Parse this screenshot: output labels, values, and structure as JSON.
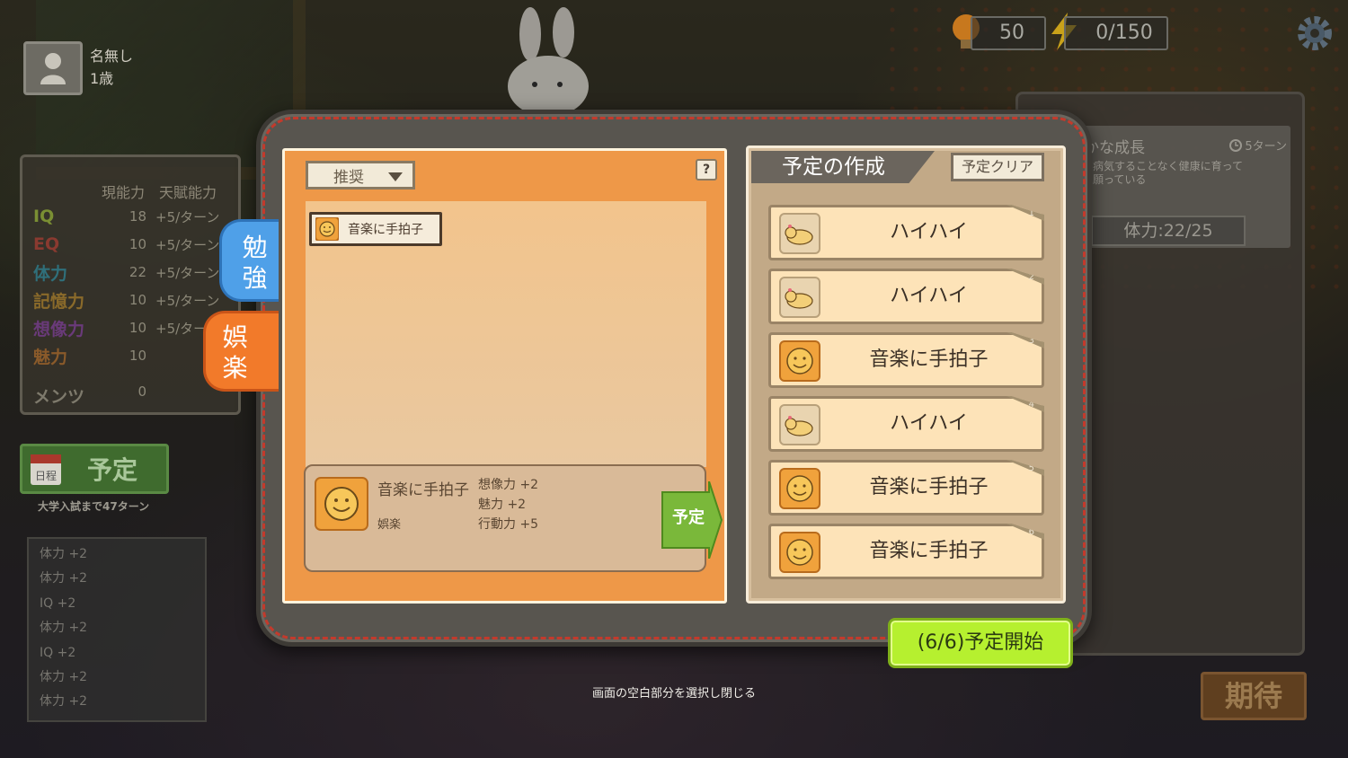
{
  "profile": {
    "name": "名無し",
    "age": "1歳"
  },
  "resources": {
    "bulb": "50",
    "energy": "0/150"
  },
  "stats": {
    "headers": [
      "現能力",
      "天賦能力"
    ],
    "rows": [
      {
        "name": "IQ",
        "value": "18",
        "rate": "+5/ターン",
        "color": "#7a8f33"
      },
      {
        "name": "EQ",
        "value": "10",
        "rate": "+5/ターン",
        "color": "#8a3a30"
      },
      {
        "name": "体力",
        "value": "22",
        "rate": "+5/ターン",
        "color": "#2f6f7a"
      },
      {
        "name": "記憶力",
        "value": "10",
        "rate": "+5/ターン",
        "color": "#8a6a2a"
      },
      {
        "name": "想像力",
        "value": "10",
        "rate": "+5/ター",
        "color": "#6a3a7a"
      },
      {
        "name": "魅力",
        "value": "10",
        "rate": "",
        "color": "#8a5a2a"
      }
    ],
    "mental": {
      "name": "メンツ",
      "value": "0"
    }
  },
  "schedule_button": {
    "calendar": "日程",
    "label": "予定"
  },
  "exam_turns": "大学入試まで47ターン",
  "log": [
    "体力 +2",
    "体力 +2",
    "IQ +2",
    "体力 +2",
    "IQ +2",
    "体力 +2",
    "体力 +2"
  ],
  "growth": {
    "title": "かな成長",
    "turns": "5ターン",
    "desc": "、病気することなく健康に育って\nと願っている",
    "hp": "体力:22/25"
  },
  "expect_button": "期待",
  "tabs": {
    "study": [
      "勉",
      "強"
    ],
    "fun": [
      "娯",
      "楽"
    ]
  },
  "sort": {
    "selected": "推奨"
  },
  "help": "?",
  "activity_list": [
    {
      "label": "音楽に手拍子",
      "icon": "smile-icon"
    }
  ],
  "detail": {
    "name": "音楽に手拍子",
    "category": "娯楽",
    "effects": [
      "想像力 +2",
      "魅力 +2",
      "行動力 +5"
    ],
    "plan_button": "予定"
  },
  "schedule": {
    "title": "予定の作成",
    "clear": "予定クリア",
    "slots": [
      {
        "num": "1",
        "label": "ハイハイ",
        "icon": "baby-crawl-icon"
      },
      {
        "num": "2",
        "label": "ハイハイ",
        "icon": "baby-crawl-icon"
      },
      {
        "num": "3",
        "label": "音楽に手拍子",
        "icon": "smile-icon"
      },
      {
        "num": "4",
        "label": "ハイハイ",
        "icon": "baby-crawl-icon"
      },
      {
        "num": "5",
        "label": "音楽に手拍子",
        "icon": "smile-icon"
      },
      {
        "num": "6",
        "label": "音楽に手拍子",
        "icon": "smile-icon"
      }
    ]
  },
  "start_button": "(6/6)予定開始",
  "close_hint": "画面の空白部分を選択し閉じる",
  "colors": {
    "accent_orange": "#ee9848",
    "study_blue": "#4fa0e8",
    "start_green": "#b6f02f"
  }
}
